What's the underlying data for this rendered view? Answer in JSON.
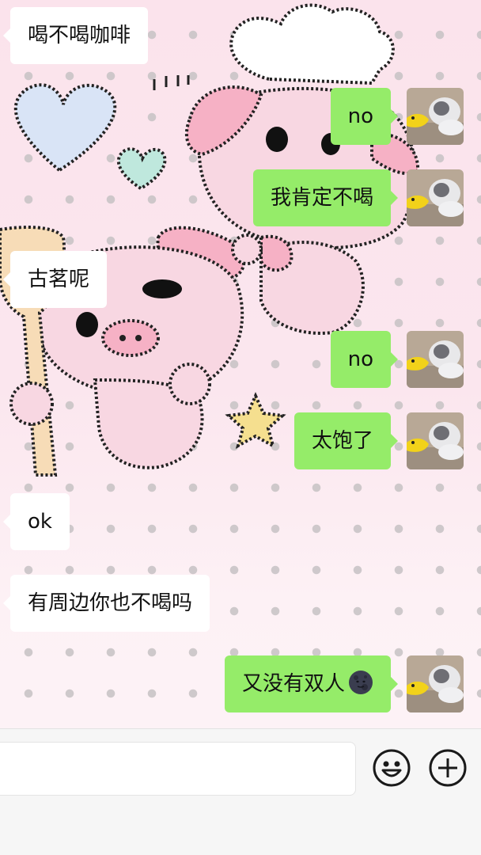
{
  "chat": {
    "messages": [
      {
        "side": "in",
        "text": "喝不喝咖啡"
      },
      {
        "side": "out",
        "text": "no"
      },
      {
        "side": "out",
        "text": "我肯定不喝"
      },
      {
        "side": "in",
        "text": "古茗呢"
      },
      {
        "side": "out",
        "text": "no"
      },
      {
        "side": "out",
        "text": "太饱了"
      },
      {
        "side": "in",
        "text": "ok"
      },
      {
        "side": "in",
        "text": "有周边你也不喝吗"
      },
      {
        "side": "out",
        "text": "又没有双人",
        "emoji": "new-moon-face-emoji"
      }
    ]
  },
  "composer": {
    "input_value": "",
    "emoji_icon": "smiley-icon",
    "more_icon": "plus-circle-icon"
  },
  "colors": {
    "outgoing_bubble": "#95ec69",
    "incoming_bubble": "#ffffff",
    "composer_bg": "#f6f6f6"
  }
}
